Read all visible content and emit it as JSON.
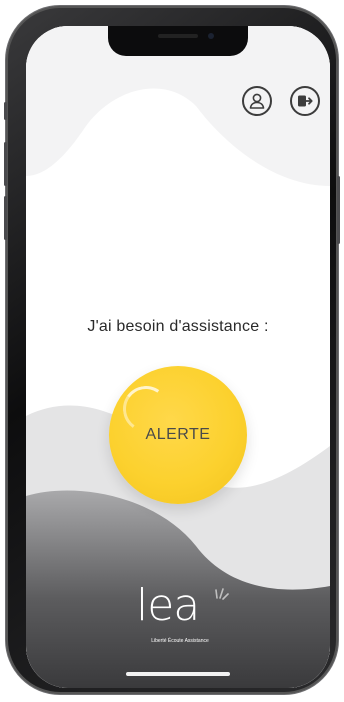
{
  "app": {
    "prompt": "J'ai besoin d'assistance :",
    "alert_button_label": "ALERTE",
    "logo_text": "lea",
    "logo_tagline": "Liberté Écoute Assistance"
  },
  "header": {
    "profile_icon": "user-icon",
    "logout_icon": "logout-icon"
  },
  "colors": {
    "alert_yellow": "#fcd12e",
    "dark_gradient": "#4b4b4d",
    "light_gray": "#e7e7e7",
    "text": "#2a2a2a"
  }
}
